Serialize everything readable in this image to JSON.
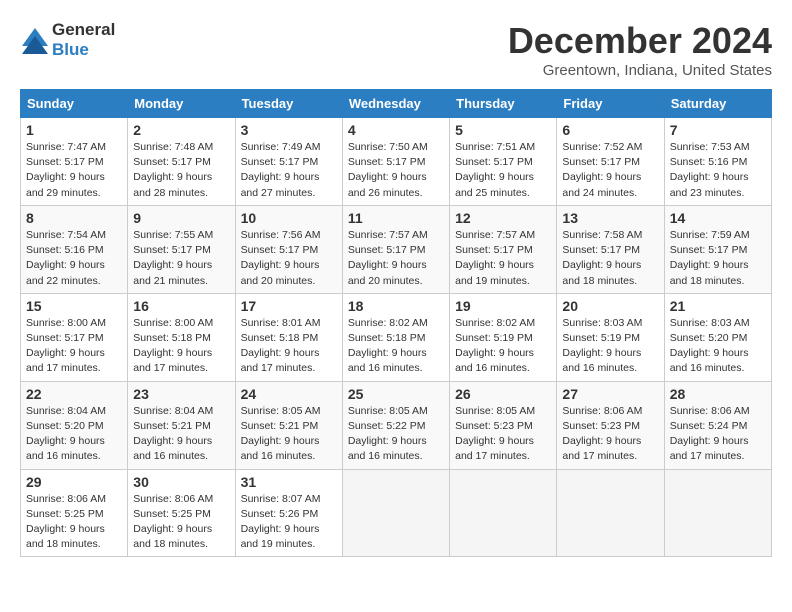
{
  "logo": {
    "general": "General",
    "blue": "Blue"
  },
  "title": "December 2024",
  "location": "Greentown, Indiana, United States",
  "days_of_week": [
    "Sunday",
    "Monday",
    "Tuesday",
    "Wednesday",
    "Thursday",
    "Friday",
    "Saturday"
  ],
  "weeks": [
    [
      {
        "day": "1",
        "sunrise": "7:47 AM",
        "sunset": "5:17 PM",
        "daylight": "9 hours and 29 minutes."
      },
      {
        "day": "2",
        "sunrise": "7:48 AM",
        "sunset": "5:17 PM",
        "daylight": "9 hours and 28 minutes."
      },
      {
        "day": "3",
        "sunrise": "7:49 AM",
        "sunset": "5:17 PM",
        "daylight": "9 hours and 27 minutes."
      },
      {
        "day": "4",
        "sunrise": "7:50 AM",
        "sunset": "5:17 PM",
        "daylight": "9 hours and 26 minutes."
      },
      {
        "day": "5",
        "sunrise": "7:51 AM",
        "sunset": "5:17 PM",
        "daylight": "9 hours and 25 minutes."
      },
      {
        "day": "6",
        "sunrise": "7:52 AM",
        "sunset": "5:17 PM",
        "daylight": "9 hours and 24 minutes."
      },
      {
        "day": "7",
        "sunrise": "7:53 AM",
        "sunset": "5:16 PM",
        "daylight": "9 hours and 23 minutes."
      }
    ],
    [
      {
        "day": "8",
        "sunrise": "7:54 AM",
        "sunset": "5:16 PM",
        "daylight": "9 hours and 22 minutes."
      },
      {
        "day": "9",
        "sunrise": "7:55 AM",
        "sunset": "5:17 PM",
        "daylight": "9 hours and 21 minutes."
      },
      {
        "day": "10",
        "sunrise": "7:56 AM",
        "sunset": "5:17 PM",
        "daylight": "9 hours and 20 minutes."
      },
      {
        "day": "11",
        "sunrise": "7:57 AM",
        "sunset": "5:17 PM",
        "daylight": "9 hours and 20 minutes."
      },
      {
        "day": "12",
        "sunrise": "7:57 AM",
        "sunset": "5:17 PM",
        "daylight": "9 hours and 19 minutes."
      },
      {
        "day": "13",
        "sunrise": "7:58 AM",
        "sunset": "5:17 PM",
        "daylight": "9 hours and 18 minutes."
      },
      {
        "day": "14",
        "sunrise": "7:59 AM",
        "sunset": "5:17 PM",
        "daylight": "9 hours and 18 minutes."
      }
    ],
    [
      {
        "day": "15",
        "sunrise": "8:00 AM",
        "sunset": "5:17 PM",
        "daylight": "9 hours and 17 minutes."
      },
      {
        "day": "16",
        "sunrise": "8:00 AM",
        "sunset": "5:18 PM",
        "daylight": "9 hours and 17 minutes."
      },
      {
        "day": "17",
        "sunrise": "8:01 AM",
        "sunset": "5:18 PM",
        "daylight": "9 hours and 17 minutes."
      },
      {
        "day": "18",
        "sunrise": "8:02 AM",
        "sunset": "5:18 PM",
        "daylight": "9 hours and 16 minutes."
      },
      {
        "day": "19",
        "sunrise": "8:02 AM",
        "sunset": "5:19 PM",
        "daylight": "9 hours and 16 minutes."
      },
      {
        "day": "20",
        "sunrise": "8:03 AM",
        "sunset": "5:19 PM",
        "daylight": "9 hours and 16 minutes."
      },
      {
        "day": "21",
        "sunrise": "8:03 AM",
        "sunset": "5:20 PM",
        "daylight": "9 hours and 16 minutes."
      }
    ],
    [
      {
        "day": "22",
        "sunrise": "8:04 AM",
        "sunset": "5:20 PM",
        "daylight": "9 hours and 16 minutes."
      },
      {
        "day": "23",
        "sunrise": "8:04 AM",
        "sunset": "5:21 PM",
        "daylight": "9 hours and 16 minutes."
      },
      {
        "day": "24",
        "sunrise": "8:05 AM",
        "sunset": "5:21 PM",
        "daylight": "9 hours and 16 minutes."
      },
      {
        "day": "25",
        "sunrise": "8:05 AM",
        "sunset": "5:22 PM",
        "daylight": "9 hours and 16 minutes."
      },
      {
        "day": "26",
        "sunrise": "8:05 AM",
        "sunset": "5:23 PM",
        "daylight": "9 hours and 17 minutes."
      },
      {
        "day": "27",
        "sunrise": "8:06 AM",
        "sunset": "5:23 PM",
        "daylight": "9 hours and 17 minutes."
      },
      {
        "day": "28",
        "sunrise": "8:06 AM",
        "sunset": "5:24 PM",
        "daylight": "9 hours and 17 minutes."
      }
    ],
    [
      {
        "day": "29",
        "sunrise": "8:06 AM",
        "sunset": "5:25 PM",
        "daylight": "9 hours and 18 minutes."
      },
      {
        "day": "30",
        "sunrise": "8:06 AM",
        "sunset": "5:25 PM",
        "daylight": "9 hours and 18 minutes."
      },
      {
        "day": "31",
        "sunrise": "8:07 AM",
        "sunset": "5:26 PM",
        "daylight": "9 hours and 19 minutes."
      },
      null,
      null,
      null,
      null
    ]
  ]
}
